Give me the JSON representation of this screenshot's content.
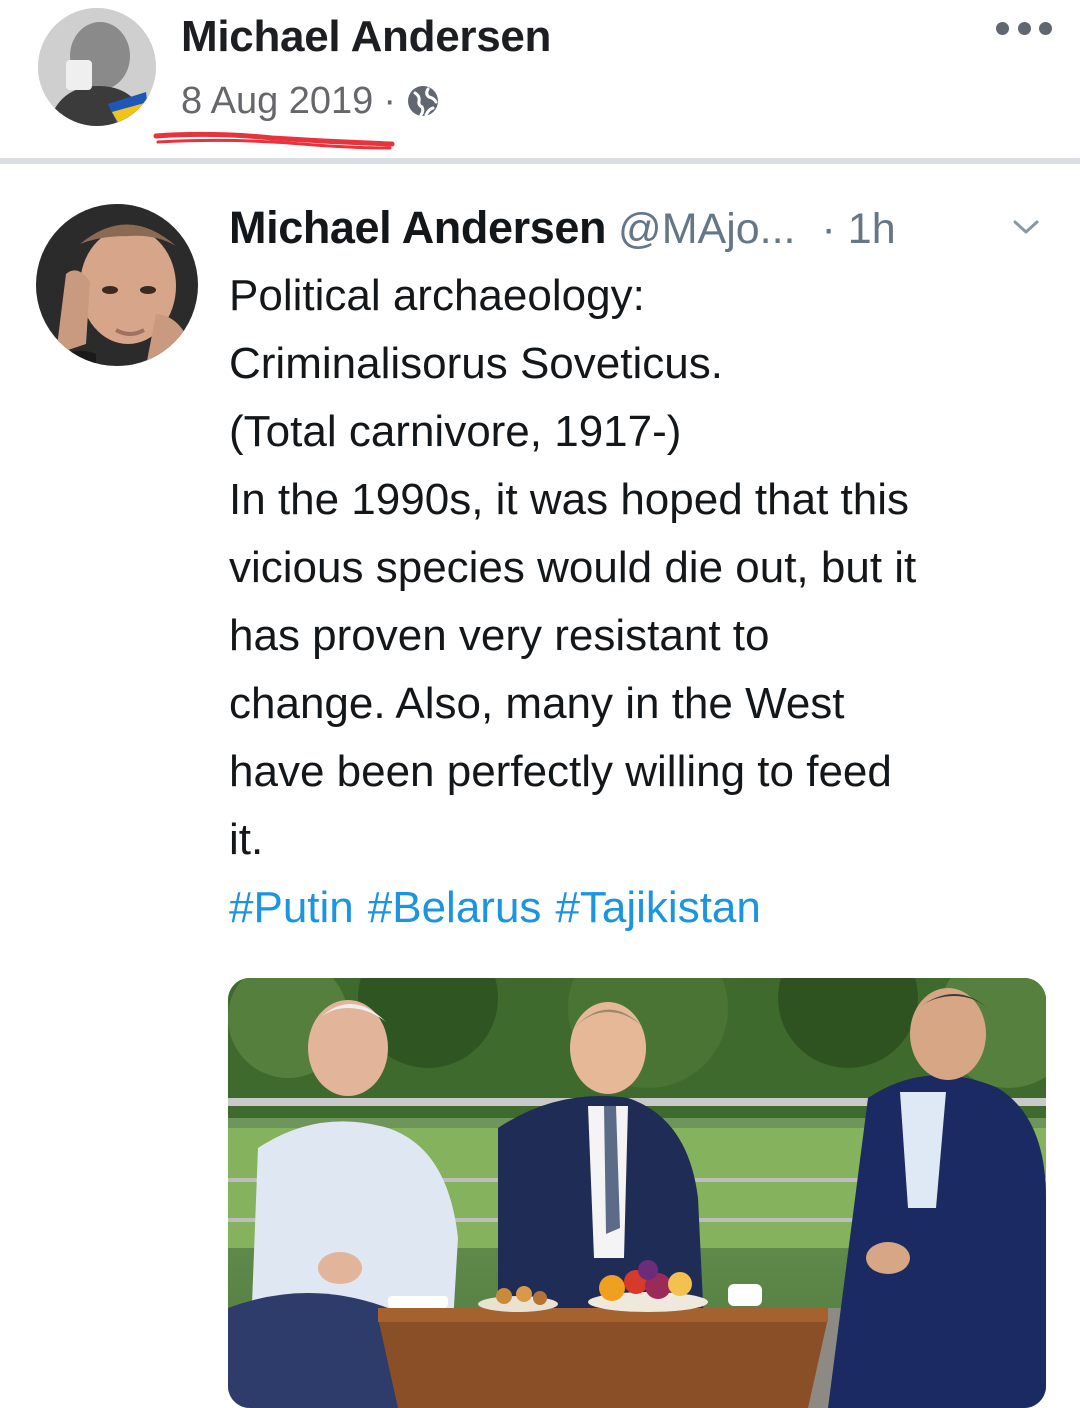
{
  "post": {
    "author_name": "Michael Andersen",
    "date": "8 Aug 2019",
    "separator": "·",
    "privacy_icon": "globe-icon",
    "more_icon": "more-horizontal-icon"
  },
  "tweet": {
    "author_name": "Michael Andersen",
    "handle": "@MAjo...",
    "time": "· 1h",
    "menu_icon": "chevron-down-icon",
    "lines": [
      "Political archaeology:",
      "Criminalisorus Soveticus.",
      "(Total carnivore, 1917-)",
      "In the 1990s, it was hoped that this",
      "vicious species would die out, but it",
      "has proven very resistant to",
      "change. Also, many in the West",
      "have been perfectly willing to feed",
      "it."
    ],
    "hashtags": [
      "#Putin",
      "#Belarus",
      "#Tajikistan"
    ],
    "photo_alt_subject": "three men seated around a table with fruit and pastries outdoors"
  },
  "colors": {
    "hashtag": "#1b95e0",
    "meta_gray": "#65676b",
    "annotation_red": "#e8323c"
  }
}
